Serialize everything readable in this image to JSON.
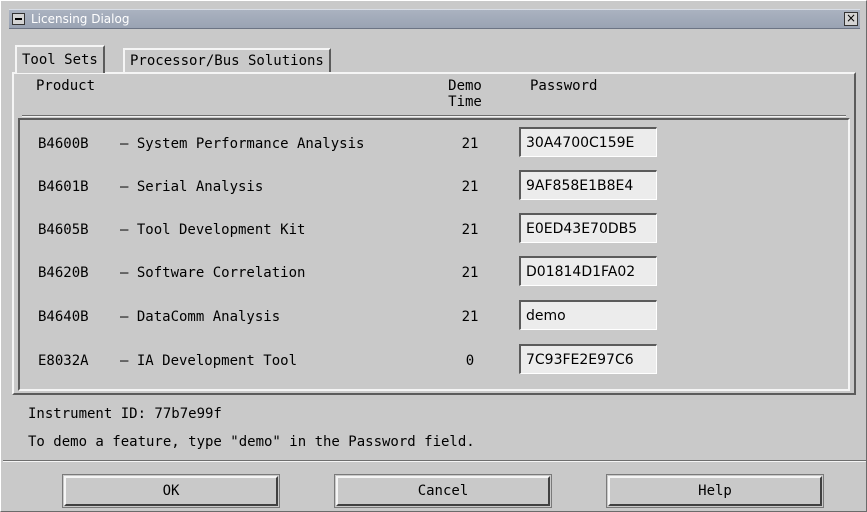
{
  "window": {
    "title": "Licensing Dialog",
    "close_glyph": "×"
  },
  "tabs": [
    {
      "label": "Tool Sets",
      "active": true
    },
    {
      "label": "Processor/Bus Solutions",
      "active": false
    }
  ],
  "columns": {
    "product": "Product",
    "demo_line1": "Demo",
    "demo_line2": "Time",
    "password": "Password"
  },
  "products": [
    {
      "code": "B4600B",
      "name": "– System Performance Analysis",
      "demo_time": "21",
      "password": "30A4700C159E"
    },
    {
      "code": "B4601B",
      "name": "– Serial Analysis",
      "demo_time": "21",
      "password": "9AF858E1B8E4"
    },
    {
      "code": "B4605B",
      "name": "– Tool Development Kit",
      "demo_time": "21",
      "password": "E0ED43E70DB5"
    },
    {
      "code": "B4620B",
      "name": "– Software Correlation",
      "demo_time": "21",
      "password": "D01814D1FA02"
    },
    {
      "code": "B4640B",
      "name": "– DataComm Analysis",
      "demo_time": "21",
      "password": "demo"
    },
    {
      "code": "E8032A",
      "name": "– IA Development Tool",
      "demo_time": "0",
      "password": "7C93FE2E97C6"
    }
  ],
  "info": {
    "instrument_id": "Instrument ID: 77b7e99f",
    "hint": "To demo a feature, type \"demo\" in the Password field."
  },
  "buttons": {
    "ok": "OK",
    "cancel": "Cancel",
    "help": "Help"
  }
}
